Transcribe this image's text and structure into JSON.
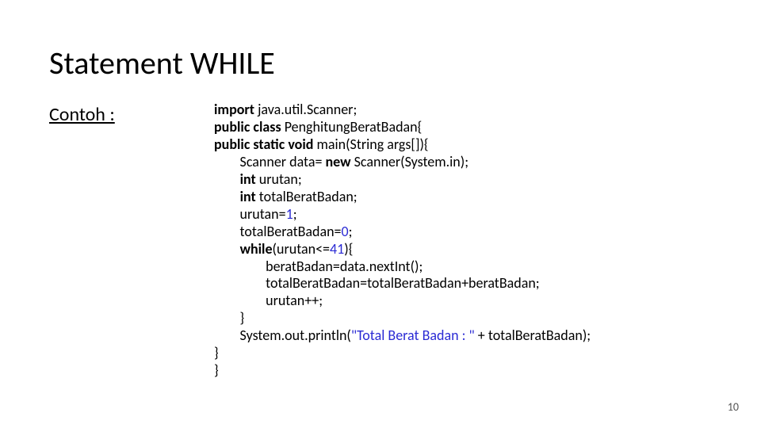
{
  "title": "Statement WHILE",
  "subtitle": "Contoh :",
  "page_number": "10",
  "code": {
    "l1": {
      "kw": "import",
      "rest": " java.util.Scanner;"
    },
    "l2": {
      "kw": "public class",
      "rest": " PenghitungBeratBadan{"
    },
    "l3": {
      "kw": "public static void",
      "rest": " main(String args[]){"
    },
    "l4a": "        Scanner data= ",
    "l4kw": "new",
    "l4b": " Scanner(System.in);",
    "l5a": "        ",
    "l5kw": "int",
    "l5b": " urutan;",
    "l6a": "        ",
    "l6kw": "int",
    "l6b": " totalBeratBadan;",
    "l7a": "        urutan=",
    "l7n": "1",
    "l7b": ";",
    "l8a": "        totalBeratBadan=",
    "l8n": "0",
    "l8b": ";",
    "l9a": "        ",
    "l9kw": "while",
    "l9b": "(urutan<=",
    "l9n": "41",
    "l9c": "){",
    "l10": "                beratBadan=data.nextInt();",
    "l11": "                totalBeratBadan=totalBeratBadan+beratBadan;",
    "l12": "                urutan++;",
    "l13": "        }",
    "l14a": "        System.out.println(",
    "l14s": "\"Total Berat Badan : \"",
    "l14b": " + totalBeratBadan);",
    "l15": "}",
    "l16": "}"
  }
}
